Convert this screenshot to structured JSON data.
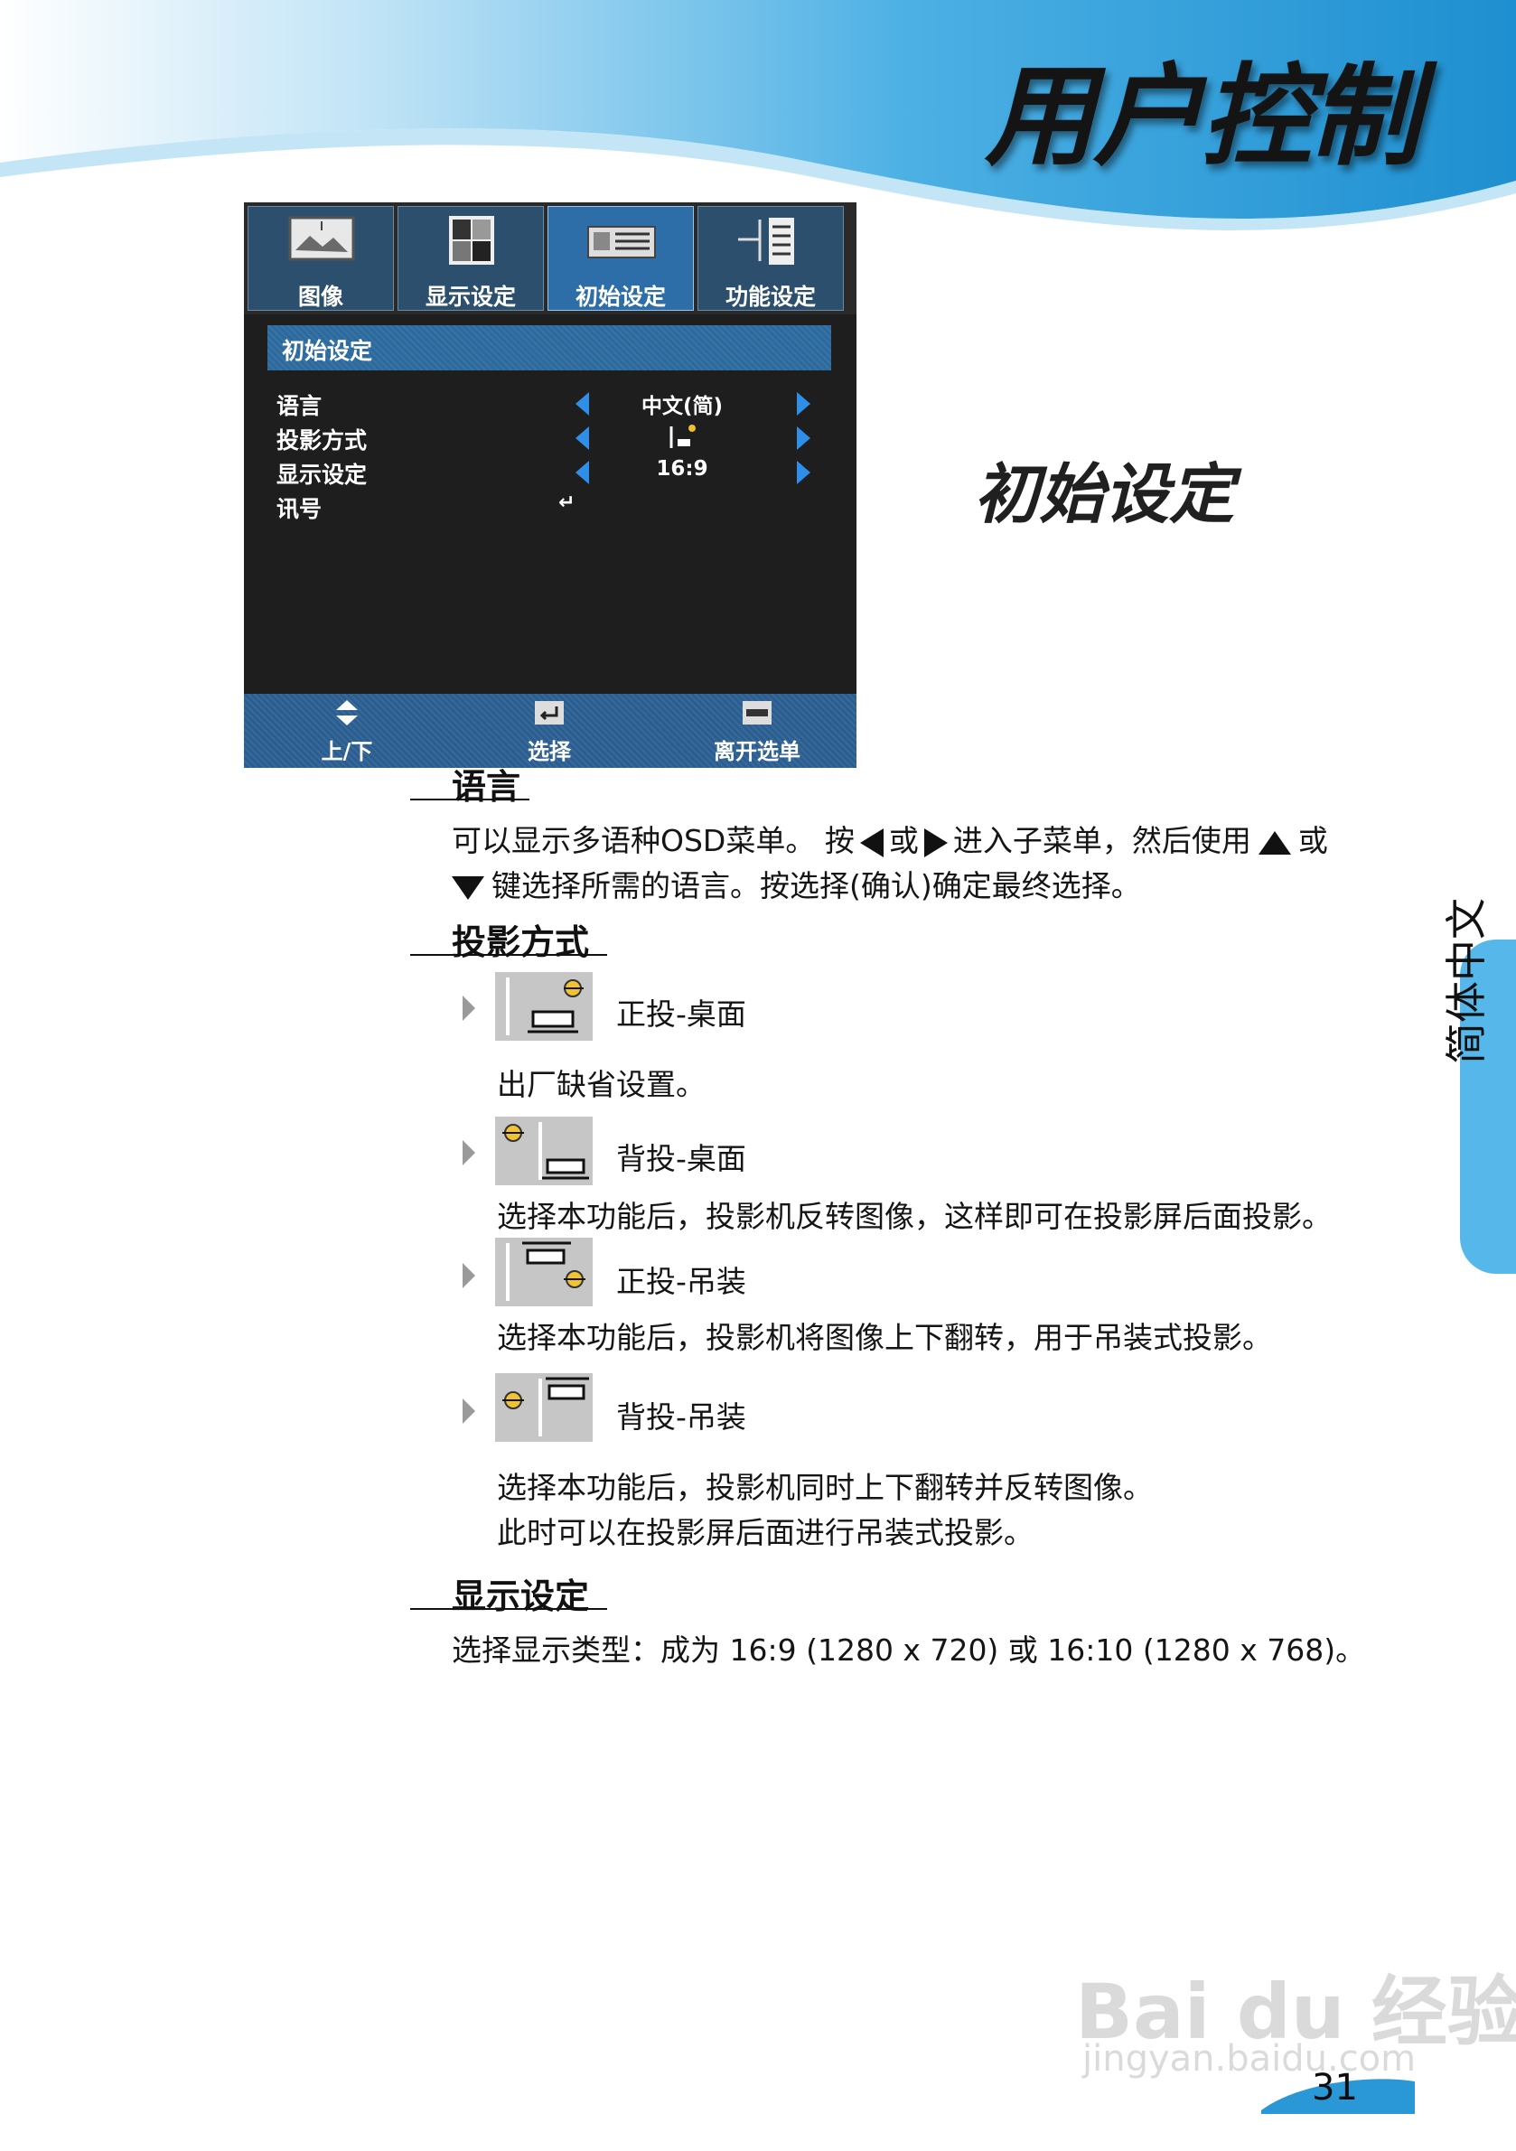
{
  "header": {
    "title": "用户控制",
    "accent_color": "#2a97d6"
  },
  "osd": {
    "tabs": [
      {
        "label": "图像",
        "icon": "image-icon"
      },
      {
        "label": "显示设定",
        "icon": "display-icon"
      },
      {
        "label": "初始设定",
        "icon": "projector-icon",
        "active": true
      },
      {
        "label": "功能设定",
        "icon": "options-icon"
      }
    ],
    "section_title": "初始设定",
    "rows": [
      {
        "label": "语言",
        "value": "中文(简)"
      },
      {
        "label": "投影方式",
        "value": ""
      },
      {
        "label": "显示设定",
        "value": "16:9"
      },
      {
        "label": "讯号",
        "value": "↵"
      }
    ],
    "footer": [
      {
        "label": "上/下",
        "icon": "up-down-icon"
      },
      {
        "label": "选择",
        "icon": "enter-icon"
      },
      {
        "label": "离开选单",
        "icon": "menu-icon"
      }
    ]
  },
  "side_heading": "初始设定",
  "sections": {
    "language": {
      "title": "语言",
      "line1_a": "可以显示多语种OSD菜单。 按",
      "line1_b": "或",
      "line1_c": "进入子菜单，然后使用",
      "line1_d": "或",
      "line2": "键选择所需的语言。按选择(确认)确定最终选择。"
    },
    "projection": {
      "title": "投影方式",
      "items": [
        {
          "label": "正投-桌面",
          "desc": "出厂缺省设置。"
        },
        {
          "label": "背投-桌面",
          "desc": "选择本功能后，投影机反转图像，这样即可在投影屏后面投影。"
        },
        {
          "label": "正投-吊装",
          "desc": "选择本功能后，投影机将图像上下翻转，用于吊装式投影。"
        },
        {
          "label": "背投-吊装",
          "desc": "选择本功能后，投影机同时上下翻转并反转图像。",
          "desc2": "此时可以在投影屏后面进行吊装式投影。"
        }
      ]
    },
    "display": {
      "title": "显示设定",
      "text": "选择显示类型：成为  16:9 (1280 x 720) 或 16:10 (1280 x 768)。"
    }
  },
  "side_tab": {
    "label": "简体中文"
  },
  "footer": {
    "page_number": "31",
    "watermark": "Bai du 经验",
    "watermark_url": "jingyan.baidu.com"
  }
}
